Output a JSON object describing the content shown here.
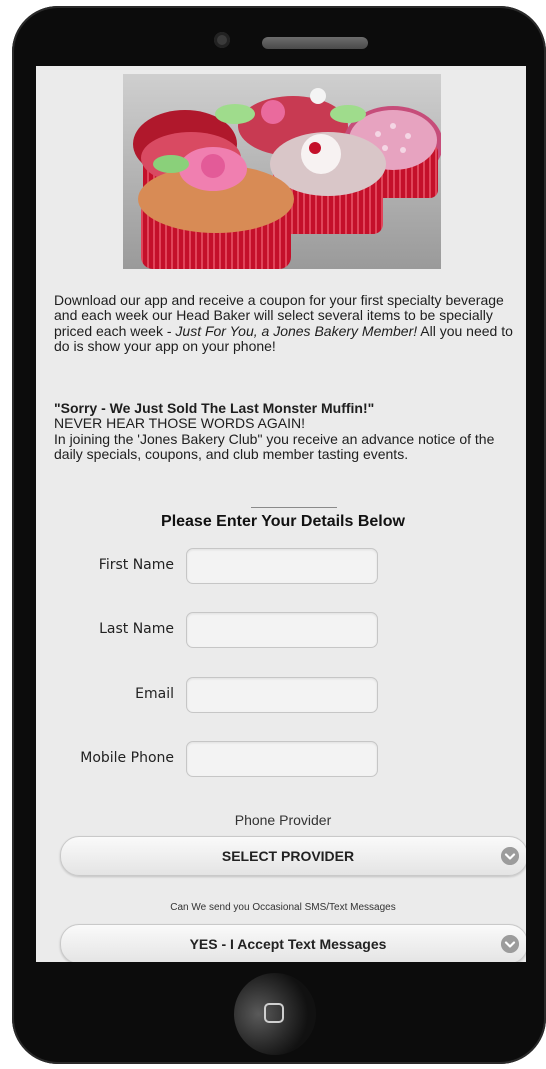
{
  "intro": {
    "text_a": "Download our app and receive a coupon for your first specialty beverage and each week our Head Baker will select several items to be specially priced each week - ",
    "text_em": "Just For You, a Jones Bakery Member!",
    "text_b": " All you need to do is show your app on your phone!"
  },
  "promo": {
    "headline": "\"Sorry - We Just Sold The Last Monster Muffin!\"",
    "line2": "NEVER HEAR THOSE WORDS AGAIN!",
    "line3": "In joining the 'Jones Bakery Club\" you receive an advance notice of the daily specials, coupons, and club member tasting events."
  },
  "form": {
    "title": "Please Enter Your Details Below",
    "fields": [
      {
        "label": "First Name",
        "value": ""
      },
      {
        "label": "Last Name",
        "value": ""
      },
      {
        "label": "Email",
        "value": ""
      },
      {
        "label": "Mobile Phone",
        "value": ""
      }
    ],
    "provider_label": "Phone Provider",
    "provider_select": "SELECT PROVIDER",
    "sms_label": "Can We send you Occasional SMS/Text Messages",
    "sms_select": "YES - I Accept Text Messages"
  },
  "icons": {
    "camera": "camera-icon",
    "speaker": "speaker-icon",
    "chevron": "chevron-down-icon",
    "home": "home-button-icon"
  },
  "colors": {
    "screen_bg": "#ebebeb",
    "phone_body": "#0c0c0c"
  }
}
